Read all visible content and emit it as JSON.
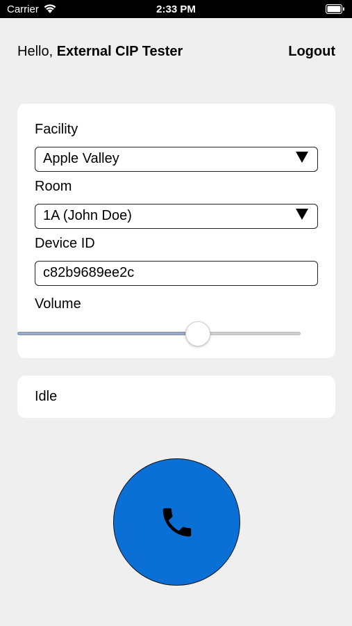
{
  "status_bar": {
    "carrier": "Carrier",
    "time": "2:33 PM"
  },
  "header": {
    "greeting_prefix": "Hello,",
    "user_name": "External CIP Tester",
    "logout_label": "Logout"
  },
  "form": {
    "facility": {
      "label": "Facility",
      "value": "Apple Valley"
    },
    "room": {
      "label": "Room",
      "value": "1A (John Doe)"
    },
    "device_id": {
      "label": "Device ID",
      "value": "c82b9689ee2c"
    },
    "volume": {
      "label": "Volume",
      "level_percent": 65
    }
  },
  "status": {
    "text": "Idle"
  },
  "colors": {
    "call_button": "#0a70d6",
    "slider_fill": "#9aaac8"
  },
  "icons": {
    "call": "phone-icon",
    "dropdown": "triangle-down-icon"
  }
}
